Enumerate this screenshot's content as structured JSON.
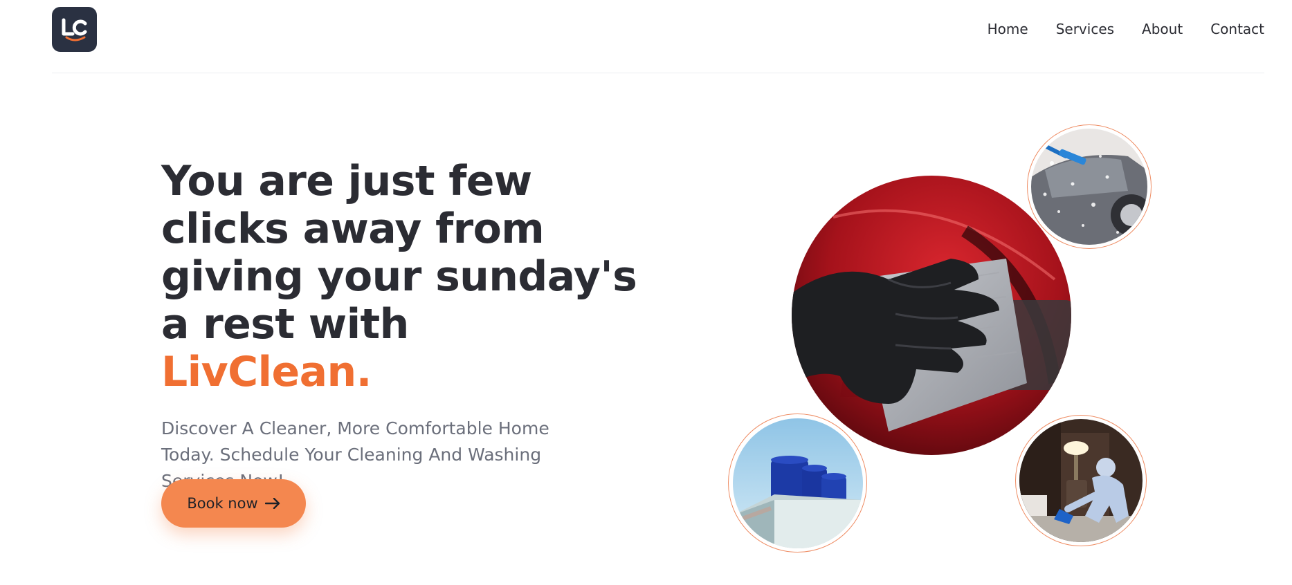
{
  "header": {
    "logo_text": "LC",
    "nav": [
      "Home",
      "Services",
      "About",
      "Contact"
    ]
  },
  "hero": {
    "headline": "You are just few clicks away from giving your sunday's a rest with",
    "brand": "LivClean.",
    "subtext": "Discover A Cleaner, More Comfortable Home Today. Schedule Your Cleaning And Washing Services Now!",
    "cta_label": "Book now"
  },
  "images": [
    {
      "name": "car-polishing",
      "desc": "gloved hand wiping red car"
    },
    {
      "name": "car-wash",
      "desc": "foam car wash"
    },
    {
      "name": "water-tanks",
      "desc": "blue rooftop water tanks"
    },
    {
      "name": "disinfection",
      "desc": "worker in protective suit disinfecting room"
    }
  ],
  "colors": {
    "accent": "#f06f32",
    "button": "#f4874f",
    "dark": "#2b2c33",
    "logo_bg": "#2a3142"
  }
}
